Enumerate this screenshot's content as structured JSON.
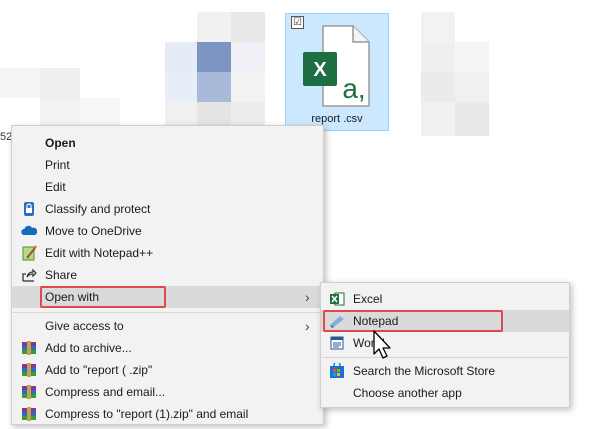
{
  "file": {
    "name": "report (1).csv",
    "name_shown": "report    .csv",
    "icon": "excel-csv-file-icon",
    "icon_letters": {
      "x": "X",
      "a": "a,"
    },
    "checkbox_glyph": "☑"
  },
  "stray_text": "52",
  "context_menu": {
    "items": [
      {
        "label": "Open",
        "icon": "",
        "bold": true
      },
      {
        "label": "Print",
        "icon": ""
      },
      {
        "label": "Edit",
        "icon": ""
      },
      {
        "label": "Classify and protect",
        "icon": "classify-lock-icon"
      },
      {
        "label": "Move to OneDrive",
        "icon": "onedrive-cloud-icon"
      },
      {
        "label": "Edit with Notepad++",
        "icon": "notepad-plus-plus-icon"
      },
      {
        "label": "Share",
        "icon": "share-icon"
      },
      {
        "label": "Open with",
        "icon": "",
        "submenu": true,
        "highlighted": true
      },
      {
        "label": "Give access to",
        "icon": "",
        "submenu": true
      },
      {
        "label": "Add to archive...",
        "icon": "winrar-icon"
      },
      {
        "label": "Add to \"report (1).zip\"",
        "label_shown": "Add to \"report (  .zip\"",
        "icon": "winrar-icon"
      },
      {
        "label": "Compress and email...",
        "icon": "winrar-icon"
      },
      {
        "label": "Compress to \"report (1).zip\" and email",
        "icon": "winrar-icon"
      }
    ],
    "chevron": "›"
  },
  "open_with_submenu": {
    "items": [
      {
        "label": "Excel",
        "icon": "excel-icon"
      },
      {
        "label": "Notepad",
        "icon": "notepad-icon",
        "highlighted": true
      },
      {
        "label": "WordPad",
        "label_shown": "Wor      d",
        "icon": "wordpad-icon"
      },
      {
        "label": "Search the Microsoft Store",
        "icon": "microsoft-store-icon"
      },
      {
        "label": "Choose another app",
        "icon": ""
      }
    ]
  },
  "colors": {
    "selection": "#cce8ff",
    "highlight": "#dadada",
    "annotation_red": "#e0484f",
    "excel_green": "#1d6f42",
    "menu_bg": "#f2f2f2"
  }
}
